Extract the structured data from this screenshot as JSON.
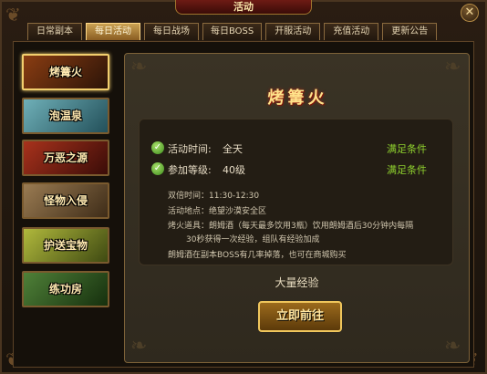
{
  "window": {
    "title": "活动",
    "close_glyph": "✕"
  },
  "tabs": [
    {
      "label": "日常副本"
    },
    {
      "label": "每日活动"
    },
    {
      "label": "每日战场"
    },
    {
      "label": "每日BOSS"
    },
    {
      "label": "开服活动"
    },
    {
      "label": "充值活动"
    },
    {
      "label": "更新公告"
    }
  ],
  "active_tab": "每日活动",
  "sidebar": {
    "items": [
      {
        "label": "烤篝火",
        "bg": "#5a2a10",
        "active": true
      },
      {
        "label": "泡温泉",
        "bg": "#2d6e7a",
        "active": false
      },
      {
        "label": "万恶之源",
        "bg": "#6a1f16",
        "active": false
      },
      {
        "label": "怪物入侵",
        "bg": "#6b5235",
        "active": false
      },
      {
        "label": "护送宝物",
        "bg": "#6d7a24",
        "active": false
      },
      {
        "label": "练功房",
        "bg": "#244a1c",
        "active": false
      }
    ]
  },
  "activity": {
    "title": "烤篝火",
    "conditions": [
      {
        "label": "活动时间:",
        "value": "全天",
        "status": "满足条件",
        "icon": "check-icon"
      },
      {
        "label": "参加等级:",
        "value": "40级",
        "status": "满足条件",
        "icon": "check-icon"
      }
    ],
    "details": [
      "双倍时间：11:30-12:30",
      "活动地点：绝望沙漠安全区",
      "烤火道具：朗姆酒（每天最多饮用3瓶）饮用朗姆酒后30分钟内每隔",
      "30秒获得一次经验，组队有经验加成",
      "朗姆酒在副本BOSS有几率掉落，也可在商城购买"
    ],
    "reward": "大量经验",
    "go_button": "立即前往"
  },
  "colors": {
    "accent_gold": "#f2cf6e",
    "status_green": "#8fd12e",
    "title_gold": "#ffe28a"
  }
}
